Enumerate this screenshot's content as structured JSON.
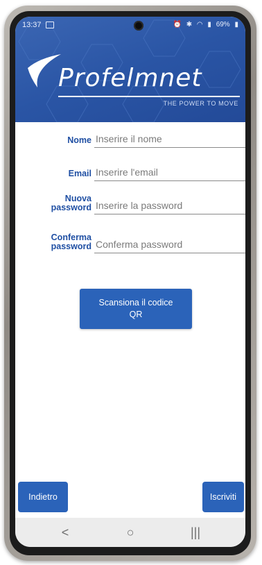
{
  "status_bar": {
    "time": "13:37",
    "battery": "69%",
    "icons": [
      "image-icon",
      "alarm-icon",
      "bluetooth-icon",
      "wifi-icon",
      "signal-icon",
      "battery-icon"
    ]
  },
  "header": {
    "logo_text": "Profelmnet",
    "tagline": "THE POWER TO MOVE",
    "brand_color": "#2a55a5"
  },
  "form": {
    "name_label": "Nome",
    "name_placeholder": "Inserire il nome",
    "email_label": "Email",
    "email_placeholder": "Inserire l'email",
    "new_password_label_1": "Nuova",
    "new_password_label_2": "password",
    "new_password_placeholder": "Inserire la password",
    "confirm_password_label_1": "Conferma",
    "confirm_password_label_2": "password",
    "confirm_password_placeholder": "Conferma password"
  },
  "scan_button": {
    "line1": "Scansiona il codice",
    "line2": "QR"
  },
  "footer": {
    "back_label": "Indietro",
    "signup_label": "Iscriviti"
  },
  "nav": {
    "back": "<",
    "home": "○",
    "recents": "|||"
  },
  "colors": {
    "accent": "#2b63b9",
    "label": "#1f4fa3"
  }
}
